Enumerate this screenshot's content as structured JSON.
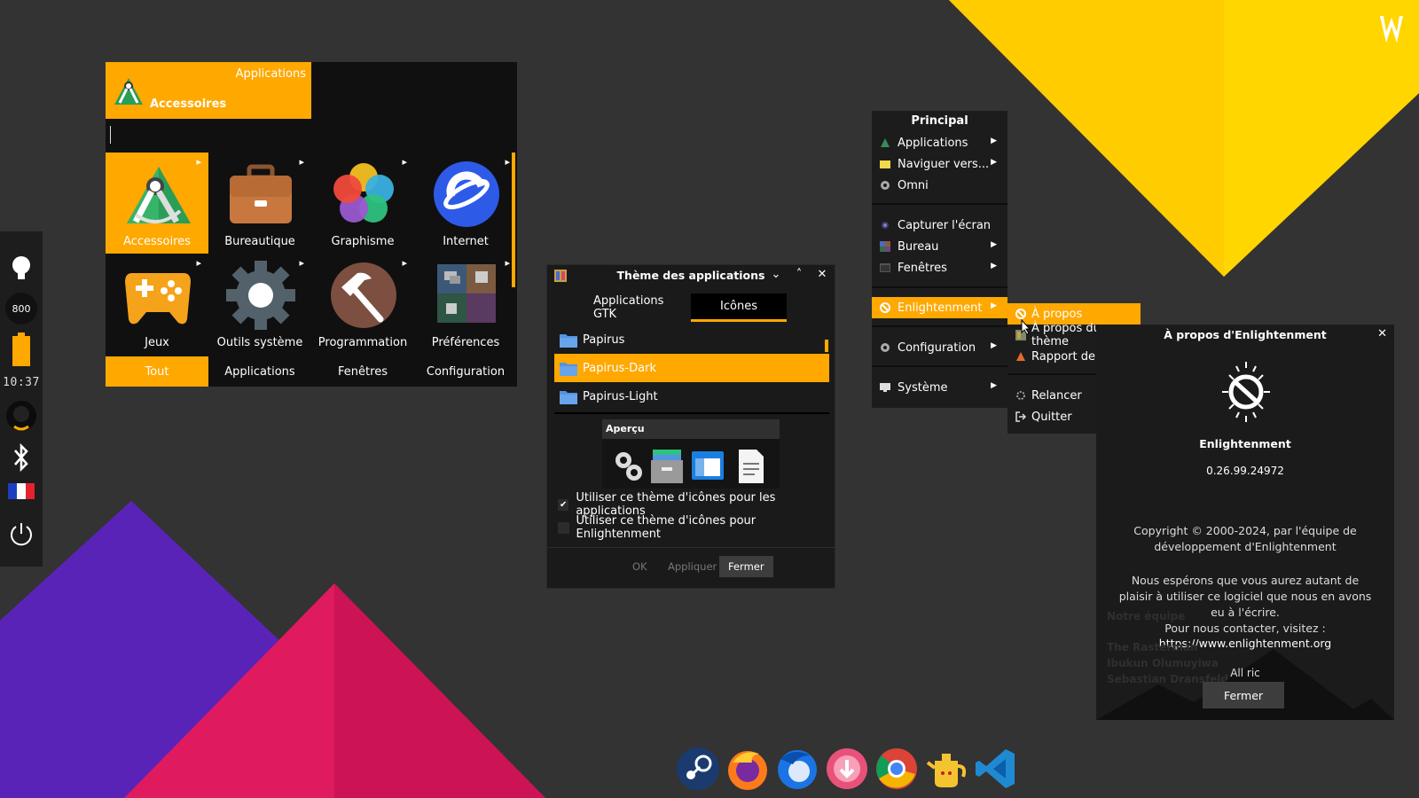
{
  "launcher": {
    "category_label": "Applications",
    "current_category": "Accessoires",
    "search_value": "",
    "apps": [
      {
        "label": "Accessoires",
        "icon": "accessories-icon"
      },
      {
        "label": "Bureautique",
        "icon": "office-briefcase-icon"
      },
      {
        "label": "Graphisme",
        "icon": "graphics-flower-icon"
      },
      {
        "label": "Internet",
        "icon": "internet-globe-icon"
      },
      {
        "label": "Jeux",
        "icon": "gamepad-icon"
      },
      {
        "label": "Outils système",
        "icon": "system-gear-icon"
      },
      {
        "label": "Programmation",
        "icon": "hammer-icon"
      },
      {
        "label": "Préférences",
        "icon": "preferences-icon"
      }
    ],
    "tabs": [
      "Tout",
      "Applications",
      "Fenêtres",
      "Configuration"
    ]
  },
  "shelf": {
    "cpu_freq": "800",
    "clock": "10:37"
  },
  "theme_dialog": {
    "title": "Thème des applications",
    "tabs": [
      "Applications GTK",
      "Icônes"
    ],
    "themes": [
      "Papirus",
      "Papirus-Dark",
      "Papirus-Light"
    ],
    "selected_theme": "Papirus-Dark",
    "preview_label": "Aperçu",
    "check_apps": "Utiliser ce thème d'icônes pour les applications",
    "check_apps_checked": true,
    "check_e": "Utiliser ce thème d'icônes pour Enlightenment",
    "check_e_checked": false,
    "buttons": {
      "ok": "OK",
      "apply": "Appliquer",
      "close": "Fermer"
    }
  },
  "main_menu": {
    "title": "Principal",
    "items": [
      {
        "label": "Applications",
        "submenu": true
      },
      {
        "label": "Naviguer vers...",
        "submenu": true
      },
      {
        "label": "Omni",
        "submenu": false
      },
      {
        "label": "Capturer l'écran",
        "submenu": false
      },
      {
        "label": "Bureau",
        "submenu": true
      },
      {
        "label": "Fenêtres",
        "submenu": true
      },
      {
        "label": "Enlightenment",
        "submenu": true
      },
      {
        "label": "Configuration",
        "submenu": true
      },
      {
        "label": "Système",
        "submenu": true
      }
    ]
  },
  "sub_menu": {
    "items": [
      "À propos",
      "À propos du thème",
      "Rapport de bogue",
      "Relancer",
      "Quitter"
    ]
  },
  "about": {
    "title": "À propos d'Enlightenment",
    "name": "Enlightenment",
    "version": "0.26.99.24972",
    "copyright": "Copyright © 2000-2024, par l'équipe de développement d'Enlightenment",
    "hope": "Nous espérons que vous aurez autant de plaisir à utiliser ce logiciel que nous en avons eu à l'écrire.",
    "contact": "Pour nous contacter, visitez :",
    "url": "https://www.enlightenment.org",
    "team_heading": "Notre équipe",
    "team_1": "The Rasterman",
    "team_2": "Ibukun Olumuyiwa",
    "team_3": "Sebastian Dransfeld",
    "rights": "All ric",
    "close_button": "Fermer"
  },
  "dock": {
    "apps": [
      "steam-icon",
      "firefox-icon",
      "thunderbird-icon",
      "downloader-icon",
      "chrome-icon",
      "teapot-icon",
      "vscode-icon"
    ]
  },
  "colors": {
    "accent": "#ffa800",
    "background": "#333333",
    "panel": "#1c1c1c"
  }
}
